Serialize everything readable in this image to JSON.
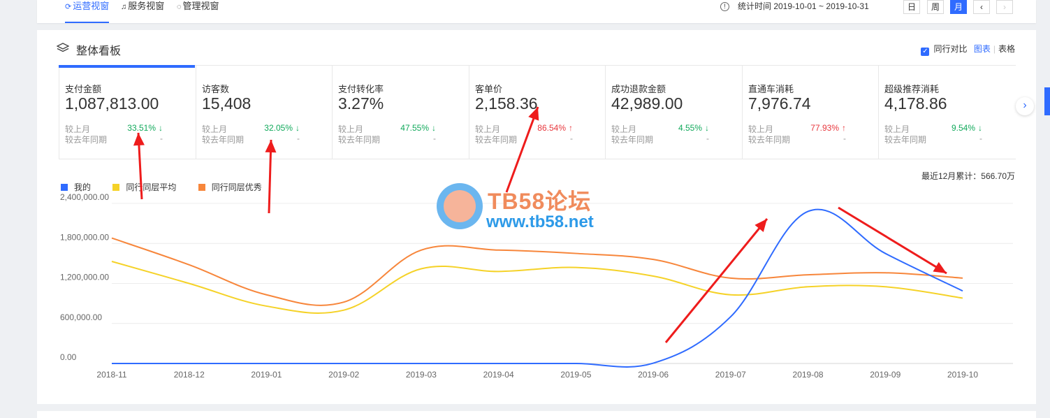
{
  "tabs": [
    {
      "label": "运营视窗",
      "icon": "refresh-icon",
      "active": true
    },
    {
      "label": "服务视窗",
      "icon": "headset-icon",
      "active": false
    },
    {
      "label": "管理视窗",
      "icon": "bulb-icon",
      "active": false
    }
  ],
  "stat_time": "统计时间 2019-10-01 ~ 2019-10-31",
  "period_buttons": [
    "日",
    "周",
    "月"
  ],
  "active_period": "月",
  "panel": {
    "title": "整体看板",
    "compare_label": "同行对比",
    "compare_checked": true,
    "view_chart": "图表",
    "view_table": "表格"
  },
  "metrics": [
    {
      "label": "支付金额",
      "value": "1,087,813.00",
      "mom_label": "较上月",
      "mom": "33.51%",
      "mom_dir": "down",
      "yoy_label": "较去年同期",
      "yoy": "-"
    },
    {
      "label": "访客数",
      "value": "15,408",
      "mom_label": "较上月",
      "mom": "32.05%",
      "mom_dir": "down",
      "yoy_label": "较去年同期",
      "yoy": "-"
    },
    {
      "label": "支付转化率",
      "value": "3.27%",
      "mom_label": "较上月",
      "mom": "47.55%",
      "mom_dir": "down",
      "yoy_label": "较去年同期",
      "yoy": "-"
    },
    {
      "label": "客单价",
      "value": "2,158.36",
      "mom_label": "较上月",
      "mom": "86.54%",
      "mom_dir": "up",
      "yoy_label": "较去年同期",
      "yoy": "-"
    },
    {
      "label": "成功退款金额",
      "value": "42,989.00",
      "mom_label": "较上月",
      "mom": "4.55%",
      "mom_dir": "down",
      "yoy_label": "较去年同期",
      "yoy": "-"
    },
    {
      "label": "直通车消耗",
      "value": "7,976.74",
      "mom_label": "较上月",
      "mom": "77.93%",
      "mom_dir": "up",
      "yoy_label": "较去年同期",
      "yoy": "-"
    },
    {
      "label": "超级推荐消耗",
      "value": "4,178.86",
      "mom_label": "较上月",
      "mom": "9.54%",
      "mom_dir": "down",
      "yoy_label": "较去年同期",
      "yoy": "-"
    }
  ],
  "cumulative": "最近12月累计：566.70万",
  "colors": {
    "mine": "#2f6bff",
    "avg": "#f5d228",
    "excellent": "#f7863b",
    "accent": "#2f6bff",
    "down": "#11a95b",
    "up": "#e8373d",
    "annotation": "#ee1c1c"
  },
  "watermark": {
    "line1": "TB58论坛",
    "line2": "www.tb58.net"
  },
  "chart_data": {
    "type": "line",
    "x": [
      "2018-11",
      "2018-12",
      "2019-01",
      "2019-02",
      "2019-03",
      "2019-04",
      "2019-05",
      "2019-06",
      "2019-07",
      "2019-08",
      "2019-09",
      "2019-10"
    ],
    "y_ticks": [
      "0.00",
      "600,000.00",
      "1,200,000.00",
      "1,800,000.00",
      "2,400,000.00"
    ],
    "ylim": [
      0,
      2400000
    ],
    "series": [
      {
        "name": "我的",
        "color": "#2f6bff",
        "values": [
          0,
          0,
          0,
          0,
          0,
          0,
          0,
          5000,
          700000,
          2280000,
          1650000,
          1087813
        ]
      },
      {
        "name": "同行同层平均",
        "color": "#f5d228",
        "values": [
          1530000,
          1200000,
          860000,
          800000,
          1420000,
          1380000,
          1440000,
          1310000,
          1030000,
          1150000,
          1150000,
          980000
        ]
      },
      {
        "name": "同行同层优秀",
        "color": "#f7863b",
        "values": [
          1880000,
          1480000,
          1030000,
          920000,
          1700000,
          1700000,
          1650000,
          1560000,
          1280000,
          1330000,
          1360000,
          1280000
        ]
      }
    ],
    "grid": true,
    "legend": "top-left"
  }
}
